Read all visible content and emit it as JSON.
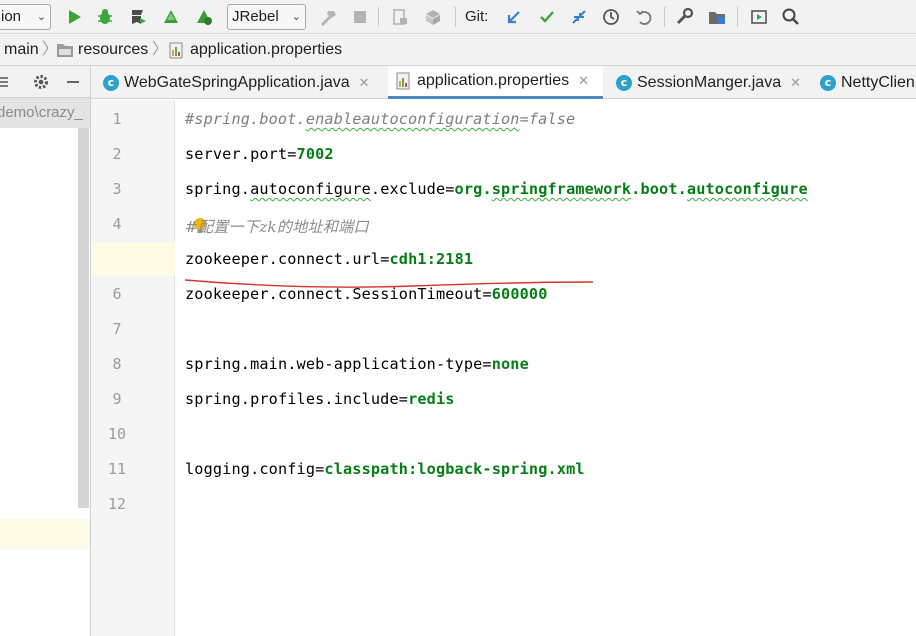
{
  "toolbar": {
    "run_config": "ion",
    "jrebel_label": "JRebel",
    "git_label": "Git:",
    "icons": [
      "run-icon",
      "debug-icon",
      "coverage-icon",
      "jrebel-run-icon",
      "jrebel-debug-icon",
      "jrebel-combo",
      "build-icon",
      "stop-icon",
      "attach-icon",
      "module-icon",
      "git-update-icon",
      "git-commit-icon",
      "git-merge-icon",
      "git-history-icon",
      "git-revert-icon",
      "settings-wrench-icon",
      "project-structure-icon",
      "presentation-icon",
      "search-icon"
    ]
  },
  "breadcrumb": {
    "items": [
      "main",
      "resources",
      "application.properties"
    ]
  },
  "left_panel": {
    "path_text": "demo\\crazy_"
  },
  "tabs": [
    {
      "label": "WebGateSpringApplication.java",
      "icon": "spring-class-icon",
      "active": false
    },
    {
      "label": "application.properties",
      "icon": "properties-file-icon",
      "active": true
    },
    {
      "label": "SessionManger.java",
      "icon": "class-icon",
      "active": false
    },
    {
      "label": "NettyClien",
      "icon": "class-icon",
      "active": false
    }
  ],
  "editor": {
    "current_line": 5,
    "line_numbers": [
      "1",
      "2",
      "3",
      "4",
      "5",
      "6",
      "7",
      "8",
      "9",
      "10",
      "11",
      "12"
    ],
    "lines": [
      {
        "comment": "#spring.boot.enableautoconfiguration=false"
      },
      {
        "key": "server.port",
        "eq": "=",
        "value": "7002"
      },
      {
        "key": "spring.autoconfigure.exclude",
        "eq": "=",
        "value": "org.springframework.boot.autoconfigure"
      },
      {
        "comment": "#配置一下zk的地址和端口"
      },
      {
        "key": "zookeeper.connect.url",
        "eq": "=",
        "value": "cdh1:2181"
      },
      {
        "key": "zookeeper.connect.SessionTimeout",
        "eq": "=",
        "value": "600000"
      },
      {},
      {
        "key": "spring.main.web-application-type",
        "eq": "=",
        "value": "none"
      },
      {
        "key": "spring.profiles.include",
        "eq": "=",
        "value": "redis"
      },
      {},
      {
        "key": "logging.config",
        "eq": "=",
        "value": "classpath:logback-spring.xml"
      },
      {}
    ]
  },
  "colors": {
    "value_green": "#067d17",
    "comment_gray": "#808080",
    "caret_row": "#fefbe6",
    "active_tab_underline": "#4a88c7",
    "annotation_red": "#d9342b"
  }
}
